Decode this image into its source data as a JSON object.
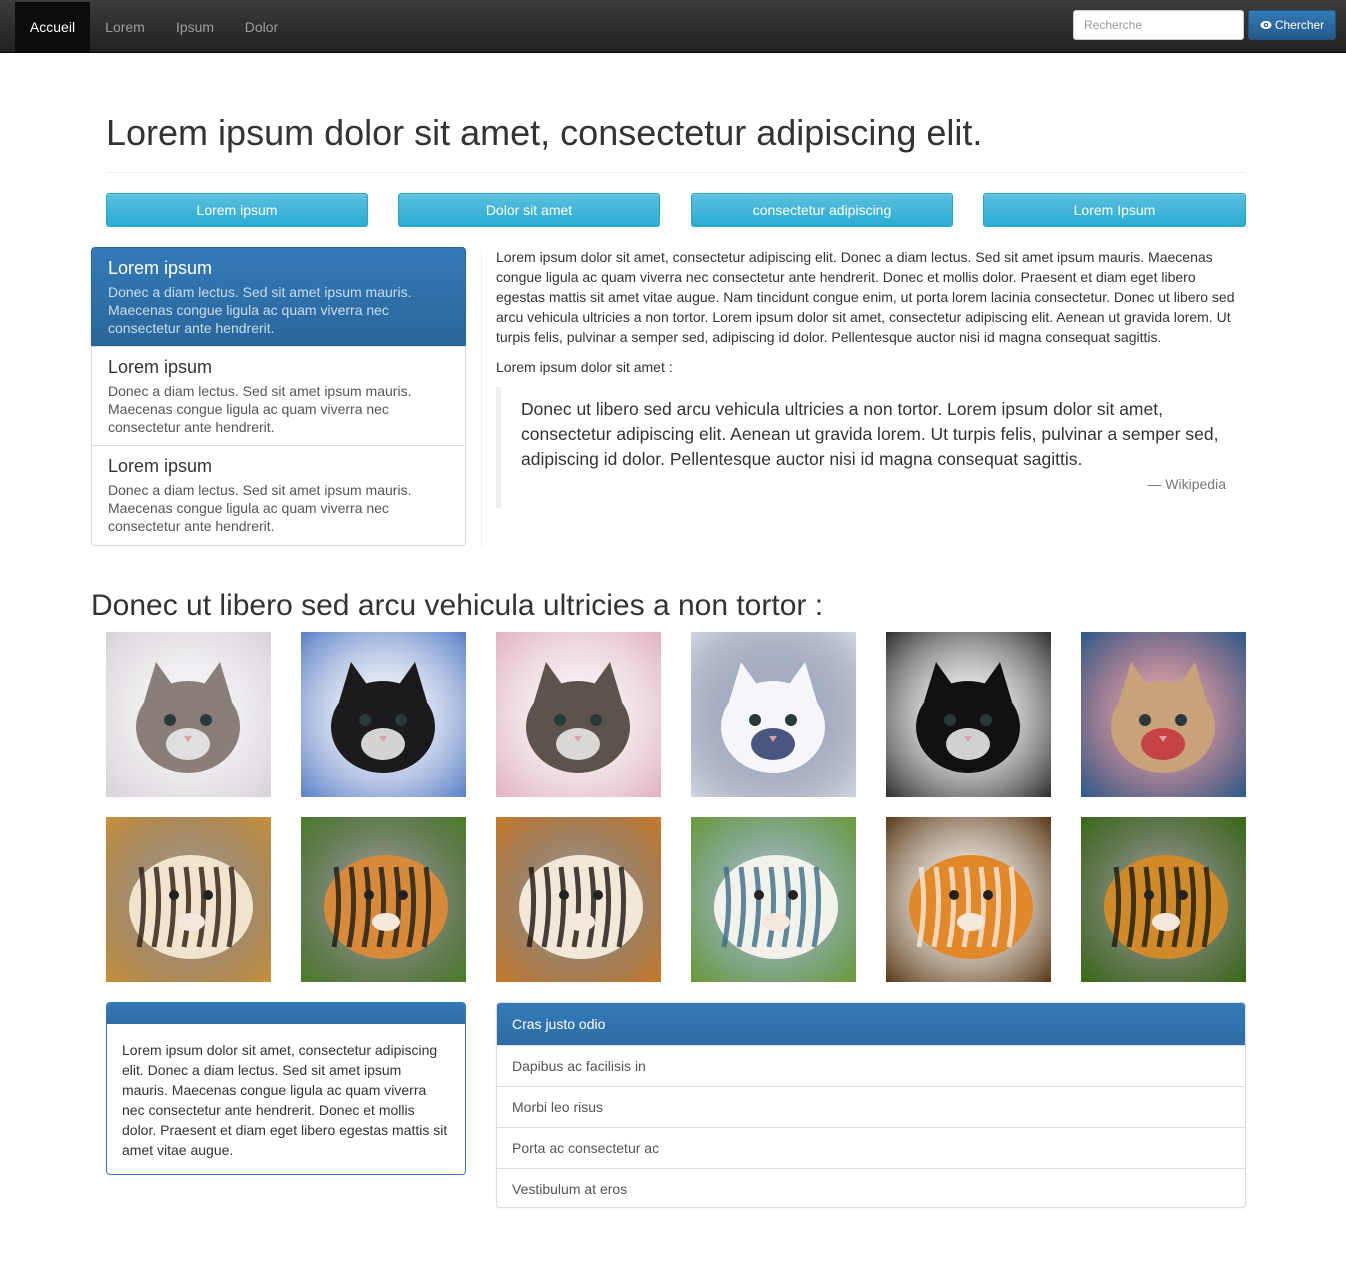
{
  "navbar": {
    "items": [
      "Accueil",
      "Lorem",
      "Ipsum",
      "Dolor"
    ],
    "search_placeholder": "Recherche",
    "search_button": "Chercher"
  },
  "header": {
    "title": "Lorem ipsum dolor sit amet, consectetur adipiscing elit."
  },
  "buttons": [
    "Lorem ipsum",
    "Dolor sit amet",
    "consectetur adipiscing",
    "Lorem Ipsum"
  ],
  "list_group": {
    "items": [
      {
        "heading": "Lorem ipsum",
        "text": "Donec a diam lectus. Sed sit amet ipsum mauris. Maecenas congue ligula ac quam viverra nec consectetur ante hendrerit."
      },
      {
        "heading": "Lorem ipsum",
        "text": "Donec a diam lectus. Sed sit amet ipsum mauris. Maecenas congue ligula ac quam viverra nec consectetur ante hendrerit."
      },
      {
        "heading": "Lorem ipsum",
        "text": "Donec a diam lectus. Sed sit amet ipsum mauris. Maecenas congue ligula ac quam viverra nec consectetur ante hendrerit."
      }
    ]
  },
  "content": {
    "paragraph": "Lorem ipsum dolor sit amet, consectetur adipiscing elit. Donec a diam lectus. Sed sit amet ipsum mauris. Maecenas congue ligula ac quam viverra nec consectetur ante hendrerit. Donec et mollis dolor. Praesent et diam eget libero egestas mattis sit amet vitae augue. Nam tincidunt congue enim, ut porta lorem lacinia consectetur. Donec ut libero sed arcu vehicula ultricies a non tortor. Lorem ipsum dolor sit amet, consectetur adipiscing elit. Aenean ut gravida lorem. Ut turpis felis, pulvinar a semper sed, adipiscing id dolor. Pellentesque auctor nisi id magna consequat sagittis.",
    "intro": "Lorem ipsum dolor sit amet :",
    "quote": "Donec ut libero sed arcu vehicula ultricies a non tortor. Lorem ipsum dolor sit amet, consectetur adipiscing elit. Aenean ut gravida lorem. Ut turpis felis, pulvinar a semper sed, adipiscing id dolor. Pellentesque auctor nisi id magna consequat sagittis.",
    "quote_source": "— Wikipedia"
  },
  "gallery": {
    "title": "Donec ut libero sed arcu vehicula ultricies a non tortor :",
    "images": [
      {
        "name": "kitten-photo-1",
        "palette": [
          "#d8d2d8",
          "#8a7f78",
          "#efeef2"
        ]
      },
      {
        "name": "kitten-photo-2",
        "palette": [
          "#5b80c8",
          "#1c1a1c",
          "#f4f4f4"
        ]
      },
      {
        "name": "kitten-photo-3",
        "palette": [
          "#e2b2c2",
          "#5c544c",
          "#f0f0f0"
        ]
      },
      {
        "name": "kitten-photo-4",
        "palette": [
          "#cfd6de",
          "#f6f6fa",
          "#2a3a6a"
        ]
      },
      {
        "name": "kitten-photo-5",
        "palette": [
          "#303030",
          "#111111",
          "#f2f2f2"
        ]
      },
      {
        "name": "kitten-photo-6",
        "palette": [
          "#2b5a8a",
          "#c8a27a",
          "#c4323c"
        ]
      },
      {
        "name": "tiger-photo-1",
        "palette": [
          "#c8903a",
          "#f0e4cc",
          "#2a1a10"
        ]
      },
      {
        "name": "tiger-photo-2",
        "palette": [
          "#4a7a2a",
          "#d88a3a",
          "#1a1a1a"
        ]
      },
      {
        "name": "tiger-photo-3",
        "palette": [
          "#c87a2a",
          "#f2e8d8",
          "#1a1410"
        ]
      },
      {
        "name": "tiger-photo-4",
        "palette": [
          "#6a9a3a",
          "#f2f2ea",
          "#3a6a8a"
        ]
      },
      {
        "name": "tiger-photo-5",
        "palette": [
          "#5a3a1a",
          "#e0882a",
          "#f2eadc"
        ]
      },
      {
        "name": "tiger-photo-6",
        "palette": [
          "#3a6a1a",
          "#d08a2a",
          "#1a1a10"
        ]
      }
    ]
  },
  "panel_left": {
    "body": "Lorem ipsum dolor sit amet, consectetur adipiscing elit. Donec a diam lectus. Sed sit amet ipsum mauris. Maecenas congue ligula ac quam viverra nec consectetur ante hendrerit. Donec et mollis dolor. Praesent et diam eget libero egestas mattis sit amet vitae augue."
  },
  "panel_right": {
    "title": "Cras justo odio",
    "items": [
      "Dapibus ac facilisis in",
      "Morbi leo risus",
      "Porta ac consectetur ac",
      "Vestibulum at eros"
    ]
  },
  "colors": {
    "navbar": "#222222",
    "primary": "#337ab7",
    "info": "#5bc0de"
  }
}
